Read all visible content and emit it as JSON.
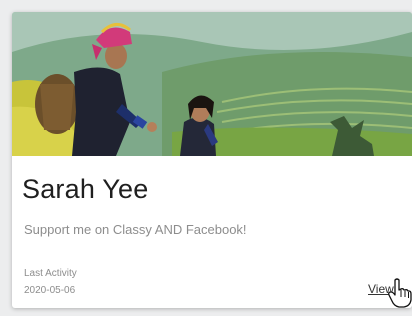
{
  "card": {
    "name": "Sarah Yee",
    "tagline": "Support me on Classy AND Facebook!",
    "activity_label": "Last Activity",
    "activity_date": "2020-05-06",
    "view_label": "View"
  },
  "colors": {
    "text_primary": "#1f1f1f",
    "text_muted": "#8d8d8d",
    "link": "#333333",
    "card_bg": "#ffffff",
    "page_bg": "#ecedee"
  },
  "icons": {
    "cursor": "hand-pointer-icon"
  }
}
